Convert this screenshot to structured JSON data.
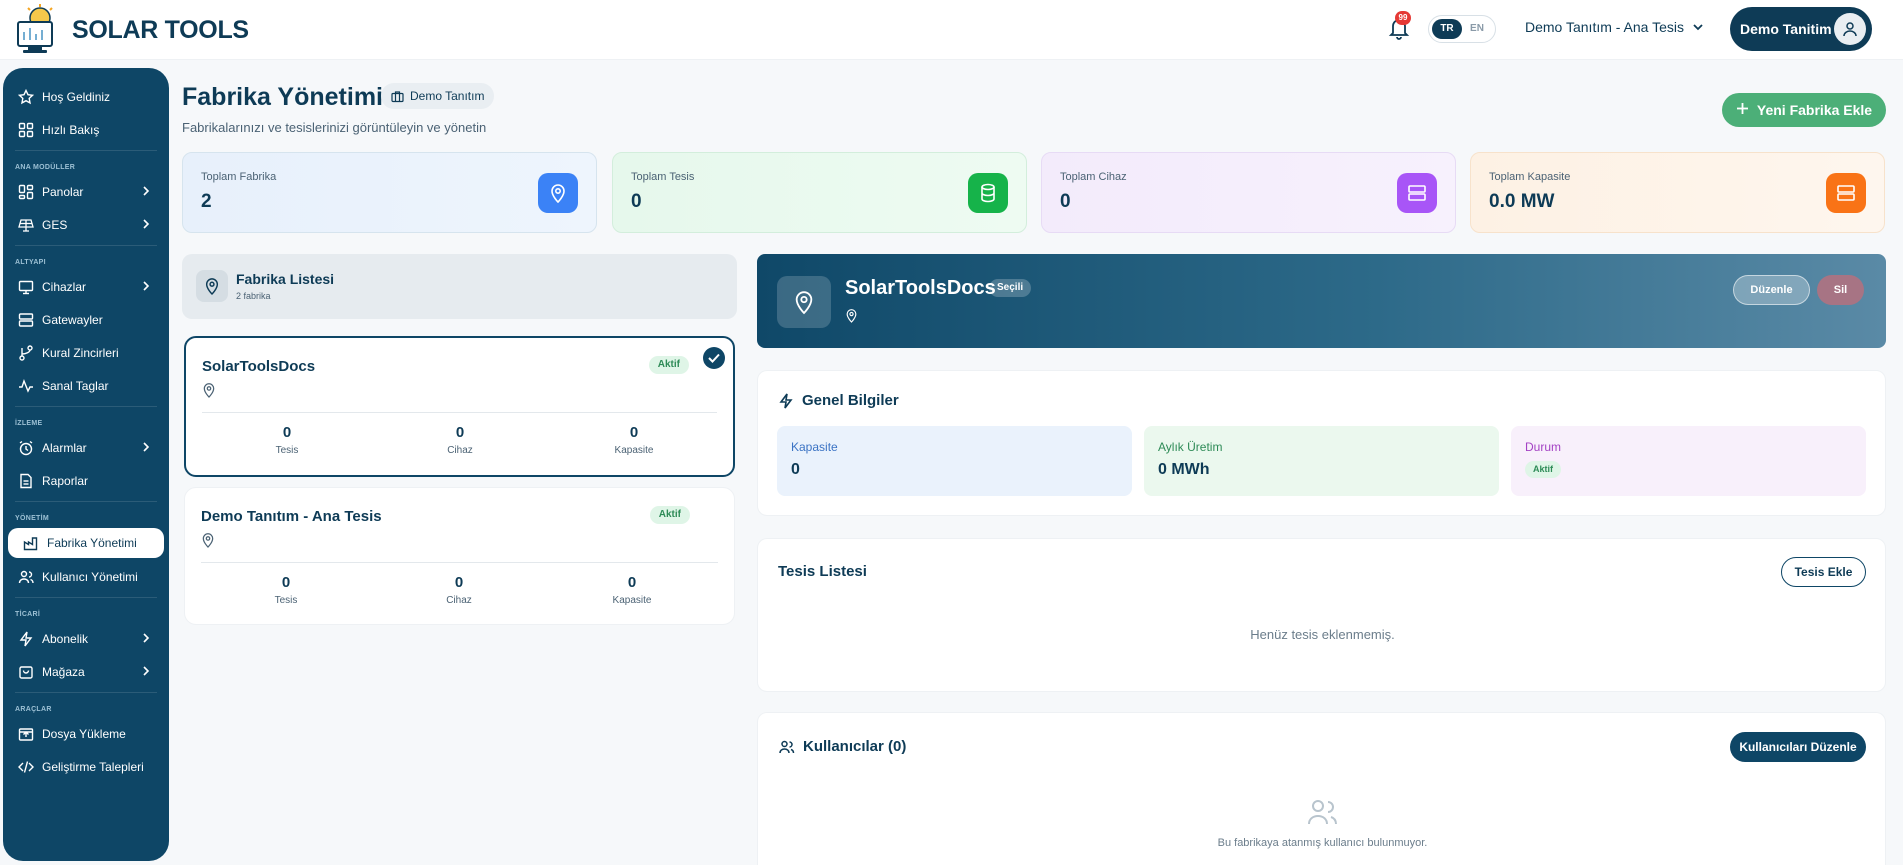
{
  "header": {
    "brand": "SOLAR TOOLS",
    "notification_count": "99",
    "lang_active": "TR",
    "lang_inactive": "EN",
    "facility_select": "Demo Tanıtım - Ana Tesis",
    "user_name": "Demo Tanitim"
  },
  "sidebar": {
    "items": [
      {
        "label": "Hoş Geldiniz",
        "icon": "star-icon"
      },
      {
        "label": "Hızlı Bakış",
        "icon": "grid-icon"
      },
      {
        "section": "ANA MODÜLLER"
      },
      {
        "label": "Panolar",
        "icon": "dashboard-icon"
      },
      {
        "label": "GES",
        "icon": "solar-panel-icon"
      },
      {
        "section": "ALTYAPI"
      },
      {
        "label": "Cihazlar",
        "icon": "monitor-icon"
      },
      {
        "label": "Gatewayler",
        "icon": "server-icon"
      },
      {
        "label": "Kural Zincirleri",
        "icon": "branch-icon"
      },
      {
        "label": "Sanal Taglar",
        "icon": "activity-icon"
      },
      {
        "section": "İZLEME"
      },
      {
        "label": "Alarmlar",
        "icon": "alarm-clock-icon"
      },
      {
        "label": "Raporlar",
        "icon": "report-icon"
      },
      {
        "section": "YÖNETİM"
      },
      {
        "label": "Fabrika Yönetimi",
        "icon": "factory-icon"
      },
      {
        "label": "Kullanıcı Yönetimi",
        "icon": "users-icon"
      },
      {
        "section": "TİCARİ"
      },
      {
        "label": "Abonelik",
        "icon": "bolt-icon"
      },
      {
        "label": "Mağaza",
        "icon": "shopping-bag-icon"
      },
      {
        "section": "ARAÇLAR"
      },
      {
        "label": "Dosya Yükleme",
        "icon": "upload-icon"
      },
      {
        "label": "Geliştirme Talepleri",
        "icon": "code-icon"
      }
    ]
  },
  "page": {
    "title": "Fabrika Yönetimi",
    "company_chip": "Demo Tanıtım",
    "subtitle": "Fabrikalarınızı ve tesislerinizi görüntüleyin ve yönetin",
    "new_factory_button": "Yeni Fabrika Ekle"
  },
  "stats": [
    {
      "label": "Toplam Fabrika",
      "value": "2",
      "icon": "map-pin-icon",
      "color": "#3b82f6"
    },
    {
      "label": "Toplam Tesis",
      "value": "0",
      "icon": "database-icon",
      "color": "#16b34a"
    },
    {
      "label": "Toplam Cihaz",
      "value": "0",
      "icon": "server-icon",
      "color": "#a855f7"
    },
    {
      "label": "Toplam Kapasite",
      "value": "0.0 MW",
      "icon": "server-icon",
      "color": "#f97316"
    }
  ],
  "factory_list": {
    "title": "Fabrika Listesi",
    "count": "2 fabrika",
    "items": [
      {
        "name": "SolarToolsDocs",
        "status": "Aktif",
        "tesis": "0",
        "tesis_label": "Tesis",
        "cihaz": "0",
        "cihaz_label": "Cihaz",
        "kapasite": "0",
        "kapasite_label": "Kapasite"
      },
      {
        "name": "Demo Tanıtım - Ana Tesis",
        "status": "Aktif",
        "tesis": "0",
        "tesis_label": "Tesis",
        "cihaz": "0",
        "cihaz_label": "Cihaz",
        "kapasite": "0",
        "kapasite_label": "Kapasite"
      }
    ]
  },
  "detail": {
    "name": "SolarToolsDocs",
    "selected_badge": "Seçili",
    "edit_button": "Düzenle",
    "delete_button": "Sil",
    "general": {
      "title": "Genel Bilgiler",
      "kapasite_label": "Kapasite",
      "kapasite_value": "0",
      "uretim_label": "Aylık Üretim",
      "uretim_value": "0 MWh",
      "durum_label": "Durum",
      "durum_value": "Aktif"
    },
    "facilities": {
      "title": "Tesis Listesi",
      "add_button": "Tesis Ekle",
      "empty": "Henüz tesis eklenmemiş."
    },
    "users": {
      "title": "Kullanıcılar (0)",
      "edit_button": "Kullanıcıları Düzenle",
      "empty": "Bu fabrikaya atanmış kullanıcı bulunmuyor."
    }
  }
}
